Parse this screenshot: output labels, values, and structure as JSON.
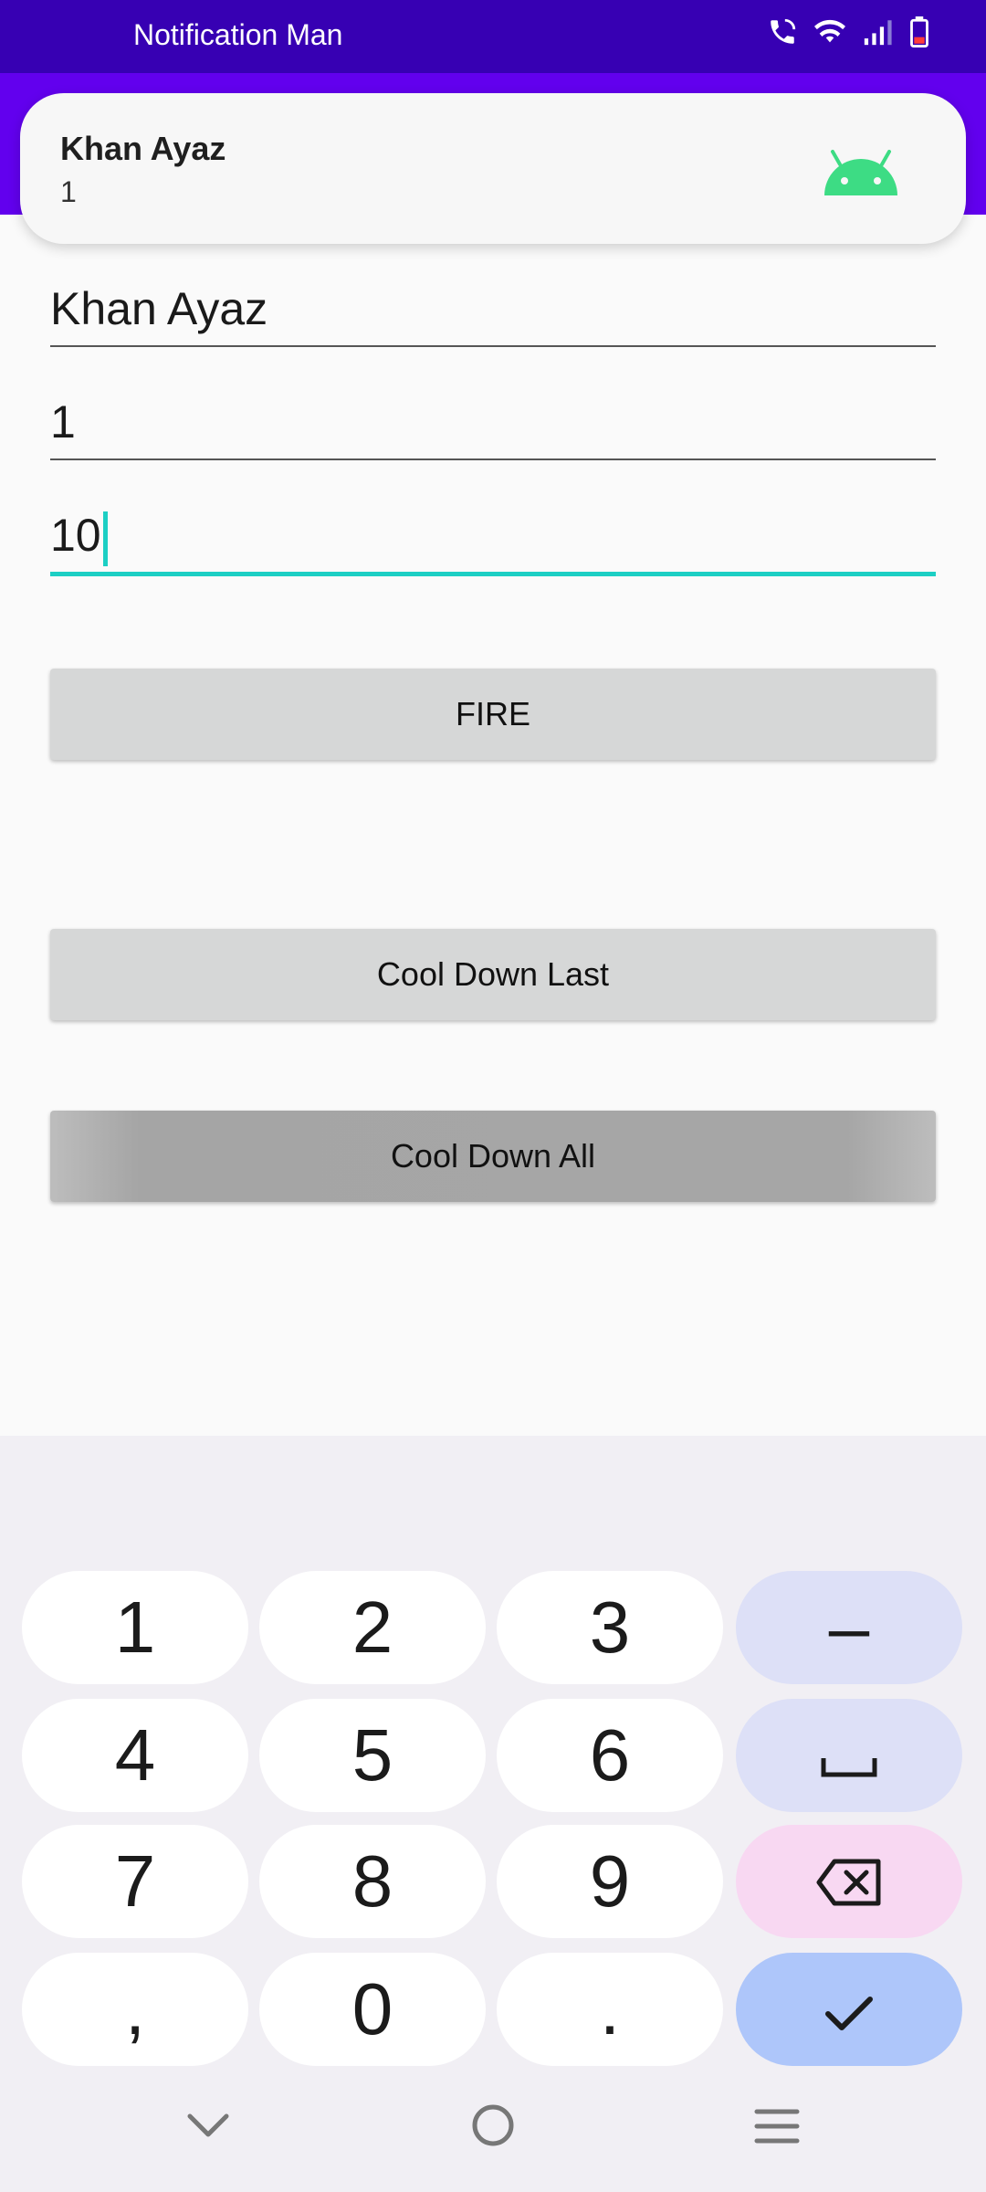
{
  "status_bar": {
    "app_title": "Notification Man"
  },
  "notification": {
    "title": "Khan Ayaz",
    "text": "1"
  },
  "form": {
    "name_value": "Khan Ayaz",
    "id_value": "1",
    "count_value": "10"
  },
  "buttons": {
    "fire": "FIRE",
    "cool_down_last": "Cool Down Last",
    "cool_down_all": "Cool Down All"
  },
  "keyboard": {
    "keys": [
      "1",
      "2",
      "3",
      "–",
      "4",
      "5",
      "6",
      "␣",
      "7",
      "8",
      "9",
      "⌫",
      ",",
      "0",
      ".",
      "✓"
    ]
  },
  "colors": {
    "status_bar": "#3700b3",
    "app_bar": "#6200ee",
    "accent": "#1ccfc4",
    "android_green": "#3ddc84"
  }
}
